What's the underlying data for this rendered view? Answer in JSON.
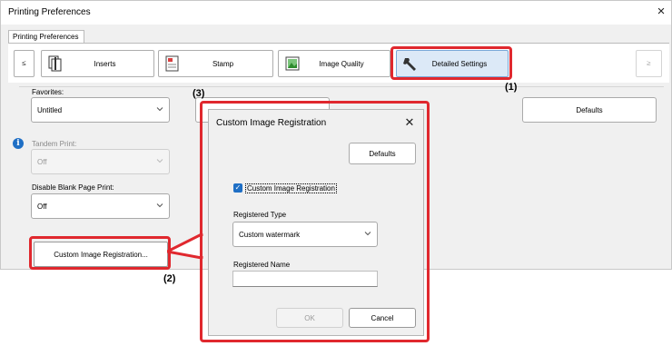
{
  "window": {
    "title": "Printing Preferences",
    "close": "×"
  },
  "outer_tab": {
    "label": "Printing Preferences"
  },
  "tabs": {
    "nav_left": "≤",
    "nav_right": "≥",
    "items": [
      {
        "label": "Inserts",
        "icon": "inserts-icon"
      },
      {
        "label": "Stamp",
        "icon": "stamp-icon"
      },
      {
        "label": "Image Quality",
        "icon": "image-quality-icon"
      },
      {
        "label": "Detailed Settings",
        "icon": "wrench-icon"
      }
    ]
  },
  "callouts": {
    "one": "(1)",
    "two": "(2)",
    "three": "(3)"
  },
  "main": {
    "favorites_label": "Favorites:",
    "favorites_value": "Untitled",
    "tandem_label": "Tandem Print:",
    "tandem_value": "Off",
    "info_glyph": "i",
    "blank_label": "Disable Blank Page Print:",
    "blank_value": "Off",
    "defaults_button": "Defaults",
    "cir_button": "Custom Image Registration..."
  },
  "dialog": {
    "title": "Custom Image Registration",
    "close": "✕",
    "defaults_button": "Defaults",
    "checkbox_label": "Custom Image Registration",
    "checkbox_checked": true,
    "check_glyph": "✓",
    "registered_type_label": "Registered Type",
    "registered_type_value": "Custom watermark",
    "registered_name_label": "Registered Name",
    "registered_name_value": "",
    "ok_button": "OK",
    "cancel_button": "Cancel"
  },
  "colors": {
    "callout_ring": "#e0282e",
    "selected_tab_bg": "#dce9f7",
    "accent_blue": "#1f6fc5",
    "window_bg": "#f0f0f0"
  }
}
